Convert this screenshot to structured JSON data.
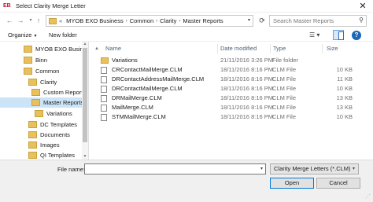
{
  "window": {
    "app_icon": "EB",
    "title": "Select Clarity Merge Letter",
    "close_glyph": "✕"
  },
  "address": {
    "overflow": "«",
    "crumbs": [
      "MYOB EXO Business",
      "Common",
      "Clarity",
      "Master Reports"
    ],
    "separator": "›"
  },
  "search": {
    "placeholder": "Search Master Reports"
  },
  "toolbar": {
    "organize_label": "Organize",
    "new_folder_label": "New folder"
  },
  "tree": {
    "items": [
      {
        "label": "MYOB EXO Business",
        "selected": false
      },
      {
        "label": "Binn",
        "selected": false
      },
      {
        "label": "Common",
        "selected": false
      },
      {
        "label": "Clarity",
        "selected": false
      },
      {
        "label": "Custom Reports",
        "selected": false
      },
      {
        "label": "Master Reports",
        "selected": true
      },
      {
        "label": "Variations",
        "selected": false
      },
      {
        "label": "DC Templates",
        "selected": false
      },
      {
        "label": "Documents",
        "selected": false
      },
      {
        "label": "Images",
        "selected": false
      },
      {
        "label": "QI Templates",
        "selected": false
      }
    ]
  },
  "files": {
    "columns": [
      "Name",
      "Date modified",
      "Type",
      "Size"
    ],
    "rows": [
      {
        "name": "Variations",
        "date": "21/11/2016 3:26 PM",
        "type": "File folder",
        "size": "",
        "kind": "folder"
      },
      {
        "name": "CRContactMailMerge.CLM",
        "date": "18/11/2016 8:16 PM",
        "type": "CLM File",
        "size": "10 KB",
        "kind": "file"
      },
      {
        "name": "DRContactAddressMailMerge.CLM",
        "date": "18/11/2016 8:16 PM",
        "type": "CLM File",
        "size": "11 KB",
        "kind": "file"
      },
      {
        "name": "DRContactMailMerge.CLM",
        "date": "18/11/2016 8:16 PM",
        "type": "CLM File",
        "size": "10 KB",
        "kind": "file"
      },
      {
        "name": "DRMailMerge.CLM",
        "date": "18/11/2016 8:16 PM",
        "type": "CLM File",
        "size": "13 KB",
        "kind": "file"
      },
      {
        "name": "MailMerge.CLM",
        "date": "18/11/2016 8:16 PM",
        "type": "CLM File",
        "size": "13 KB",
        "kind": "file"
      },
      {
        "name": "STMMailMerge.CLM",
        "date": "18/11/2016 8:16 PM",
        "type": "CLM File",
        "size": "10 KB",
        "kind": "file"
      }
    ]
  },
  "bottom": {
    "file_name_label": "File name:",
    "file_name_value": "",
    "filter_value": "Clarity Merge Letters (*.CLM)",
    "open_label": "Open",
    "cancel_label": "Cancel"
  },
  "colors": {
    "selection": "#cce4f7",
    "folder": "#e8c15d",
    "accent": "#0078d7",
    "app_icon": "#c8102e"
  }
}
